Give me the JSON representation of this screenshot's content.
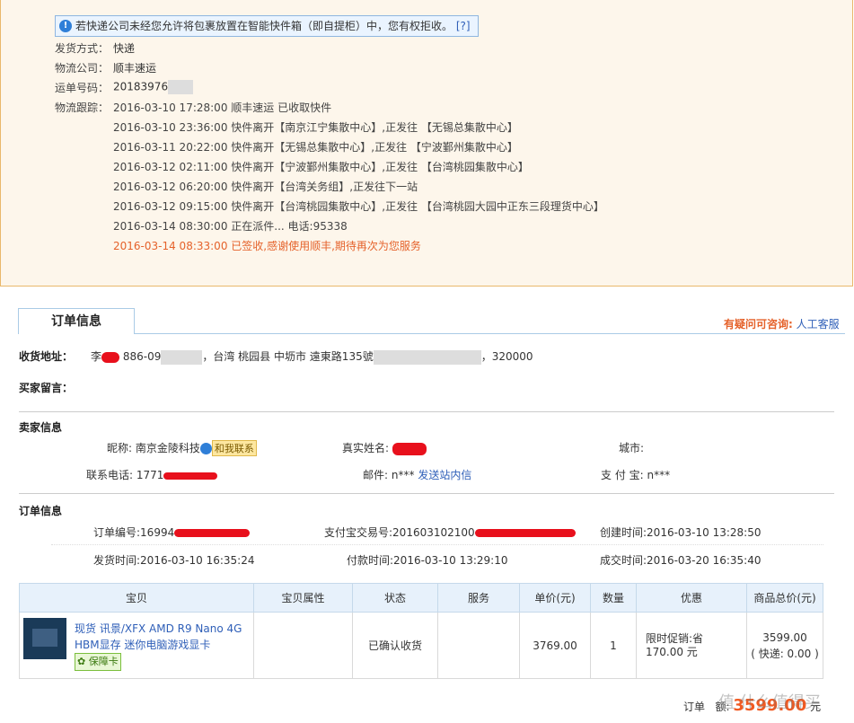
{
  "logistics": {
    "notice": "若快递公司未经您允许将包裹放置在智能快件箱（即自提柜）中，您有权拒收。",
    "notice_link": "[?]",
    "ship_method_label": "发货方式：",
    "ship_method": "快递",
    "company_label": "物流公司：",
    "company": "顺丰速运",
    "waybill_label": "运单号码：",
    "waybill": "20183976",
    "tracking_label": "物流跟踪：",
    "tracking": [
      "2016-03-10 17:28:00 顺丰速运 已收取快件",
      "2016-03-10 23:36:00 快件离开【南京江宁集散中心】,正发往 【无锡总集散中心】",
      "2016-03-11 20:22:00 快件离开【无锡总集散中心】,正发往 【宁波鄞州集散中心】",
      "2016-03-12 02:11:00 快件离开【宁波鄞州集散中心】,正发往 【台湾桃园集散中心】",
      "2016-03-12 06:20:00 快件离开【台湾关务组】,正发往下一站",
      "2016-03-12 09:15:00 快件离开【台湾桃园集散中心】,正发往 【台湾桃园大园中正东三段理货中心】",
      "2016-03-14 08:30:00 正在派件... 电话:95338",
      "2016-03-14 08:33:00 已签收,感谢使用顺丰,期待再次为您服务"
    ]
  },
  "tab_label": "订单信息",
  "help_label": "有疑问可咨询:",
  "help_link": "人工客服",
  "address_label": "收货地址：",
  "address": {
    "name": "李",
    "phone": "886-09",
    "addr": "，台湾 桃园县 中坜市 遠東路135號",
    "zip": "，320000"
  },
  "buyer_msg_label": "买家留言：",
  "seller_section": "卖家信息",
  "seller": {
    "nick_label": "昵称:",
    "nick": "南京金陵科技",
    "contact_badge": "和我联系",
    "realname_label": "真实姓名:",
    "city_label": "城市:",
    "phone_label": "联系电话:",
    "phone": "1771",
    "mail_label": "邮件:",
    "mail": "n***",
    "mail_link": "发送站内信",
    "alipay_label": "支 付 宝:",
    "alipay": "n***"
  },
  "order_section": "订单信息",
  "order": {
    "no_label": "订单编号:",
    "no": "16994",
    "trade_label": "支付宝交易号:",
    "trade": "201603102100",
    "created_label": "创建时间:",
    "created": "2016-03-10 13:28:50",
    "ship_label": "发货时间:",
    "ship": "2016-03-10 16:35:24",
    "pay_label": "付款时间:",
    "pay": "2016-03-10 13:29:10",
    "deal_label": "成交时间:",
    "deal": "2016-03-20 16:35:40"
  },
  "table": {
    "headers": [
      "宝贝",
      "宝贝属性",
      "状态",
      "服务",
      "单价(元)",
      "数量",
      "优惠",
      "商品总价(元)"
    ],
    "item_title": "现货 讯景/XFX AMD R9 Nano 4G HBM显存 迷你电脑游戏显卡",
    "guarantee": "保障卡",
    "status": "已确认收货",
    "price": "3769.00",
    "qty": "1",
    "discount_line1": "限时促销:省",
    "discount_line2": "170.00 元",
    "total": "3599.00",
    "shipping": "( 快递: 0.00 )"
  },
  "footer": {
    "label": "订单",
    "label2": "额:",
    "amount": "3599.00",
    "unit": "元",
    "watermark": "值 什么值得买"
  },
  "colors": {
    "accent_orange": "#e5622b",
    "link_blue": "#2f5fb8",
    "panel_bg": "#fdf6eb"
  }
}
